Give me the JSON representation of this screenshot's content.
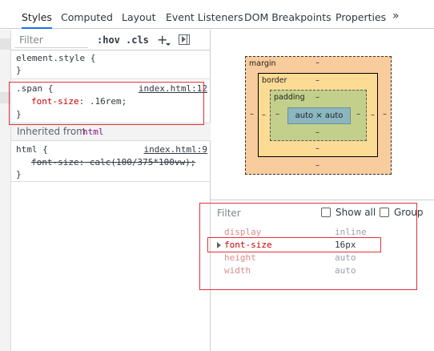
{
  "tabs": [
    "Styles",
    "Computed",
    "Layout",
    "Event Listeners",
    "DOM Breakpoints",
    "Properties"
  ],
  "more_tabs_glyph": "»",
  "styles": {
    "filter_placeholder": "Filter",
    "hov": ":hov",
    "cls": ".cls",
    "add_glyph": "+",
    "rules": {
      "element_style": {
        "open": "element.style {",
        "close": "}"
      },
      "span_rule": {
        "selector": ".span {",
        "source": "index.html:12",
        "prop": "font-size",
        "value": " .16rem;",
        "close": "}"
      },
      "html_rule": {
        "selector": "html {",
        "source": "index.html:9",
        "prop": "font-size",
        "value": " calc(100/375*100vw);",
        "close": "}"
      }
    },
    "inherited_label": "Inherited from",
    "inherited_tag": "html"
  },
  "box_model": {
    "margin_label": "margin",
    "border_label": "border",
    "padding_label": "padding",
    "dash": "–",
    "content": "auto × auto"
  },
  "computed": {
    "filter_placeholder": "Filter",
    "show_all": "Show all",
    "group": "Group",
    "rows": [
      {
        "name": "display",
        "value": "inline"
      },
      {
        "name": "font-size",
        "value": "16px"
      },
      {
        "name": "height",
        "value": "auto"
      },
      {
        "name": "width",
        "value": "auto"
      }
    ]
  },
  "colors": {
    "accent": "#1a73e8",
    "annotation": "#e0313a",
    "margin": "#f9cc9d",
    "border": "#fcdb95",
    "padding": "#c3d08b",
    "content": "#8cb6c0",
    "property": "#c80000"
  }
}
